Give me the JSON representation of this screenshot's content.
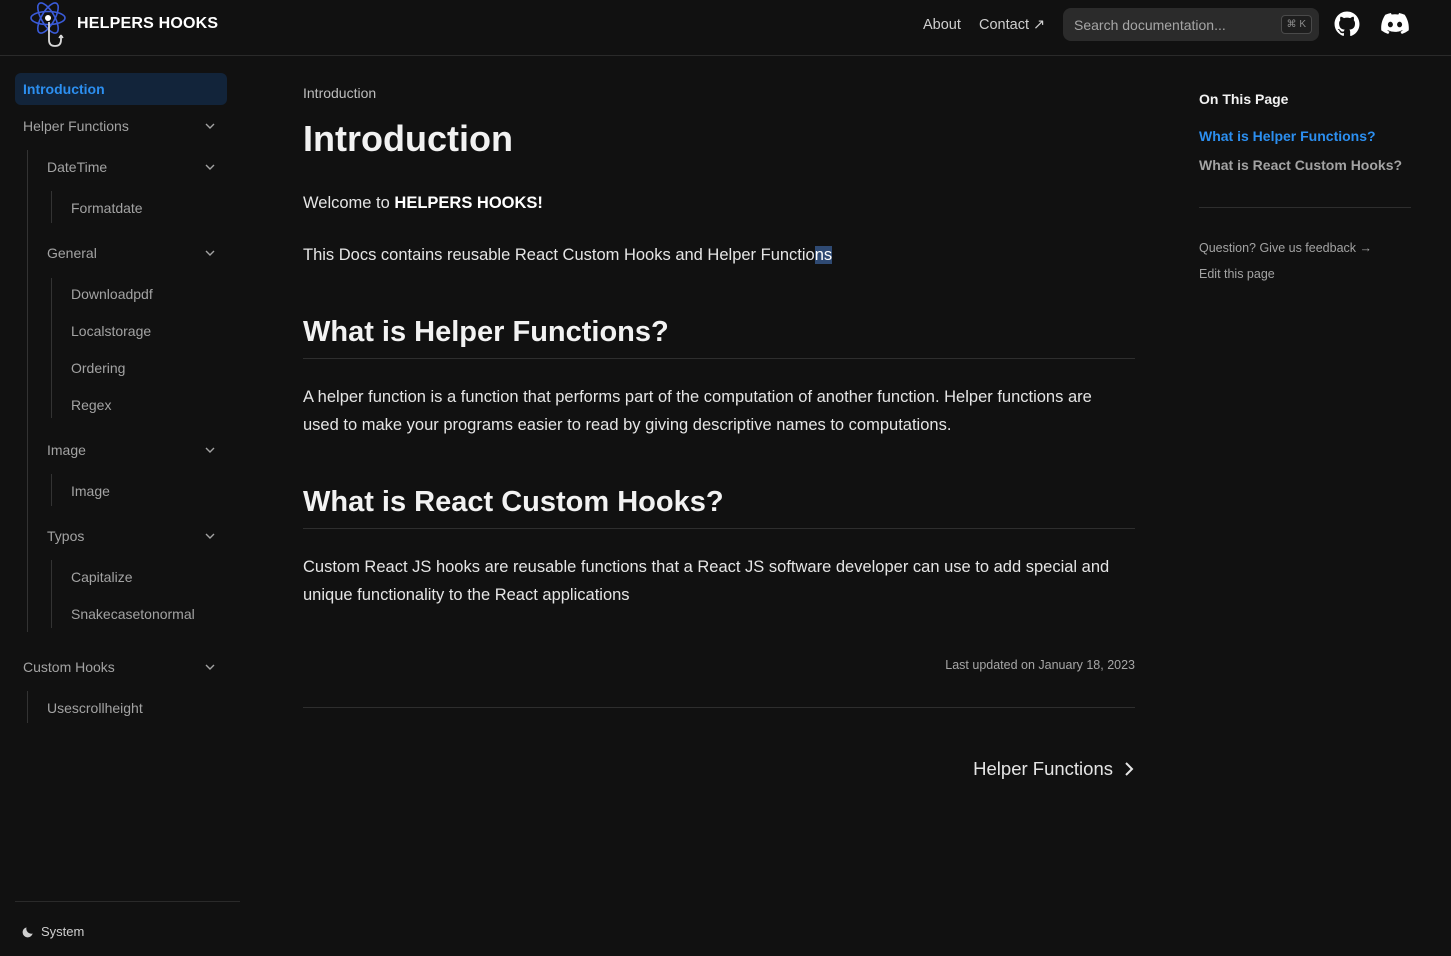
{
  "header": {
    "brand": "HELPERS HOOKS",
    "nav": {
      "about": "About",
      "contact": "Contact ↗"
    },
    "search": {
      "placeholder": "Search documentation...",
      "shortcut": "⌘ K"
    },
    "icons": [
      "atom-logo-icon",
      "github-icon",
      "discord-icon"
    ]
  },
  "sidebar": {
    "active": "Introduction",
    "helper_functions": "Helper Functions",
    "datetime": "DateTime",
    "formatdate": "Formatdate",
    "general": "General",
    "downloadpdf": "Downloadpdf",
    "localstorage": "Localstorage",
    "ordering": "Ordering",
    "regex": "Regex",
    "image_group": "Image",
    "image_item": "Image",
    "typos": "Typos",
    "capitalize": "Capitalize",
    "snakecase": "Snakecasetonormal",
    "custom_hooks": "Custom Hooks",
    "usescrollheight": "Usescrollheight",
    "theme": "System"
  },
  "main": {
    "breadcrumb": "Introduction",
    "title": "Introduction",
    "welcome_prefix": "Welcome to ",
    "welcome_bold": "HELPERS HOOKS!",
    "intro_text": "This Docs contains reusable React Custom Hooks and Helper Functio",
    "intro_highlight": "ns",
    "h2_helper": "What is Helper Functions?",
    "helper_p1": "A helper function is a function that performs part of the computation of another function. Helper functions are",
    "helper_p2": "used to make your programs easier to read by giving descriptive names to computations.",
    "h2_hooks": "What is React Custom Hooks?",
    "hooks_p1": "Custom React JS hooks are reusable functions that a React JS software developer can use to add special and",
    "hooks_p2": "unique functionality to the React applications",
    "last_updated": "Last updated on January 18, 2023",
    "next_label": "Helper Functions"
  },
  "toc": {
    "title": "On This Page",
    "link1": "What is Helper Functions?",
    "link2": "What is React Custom Hooks?",
    "feedback": "Question? Give us feedback →",
    "edit": "Edit this page"
  },
  "colors": {
    "accent": "#2c8ff0",
    "background": "#111111",
    "active_bg": "#12243a"
  }
}
